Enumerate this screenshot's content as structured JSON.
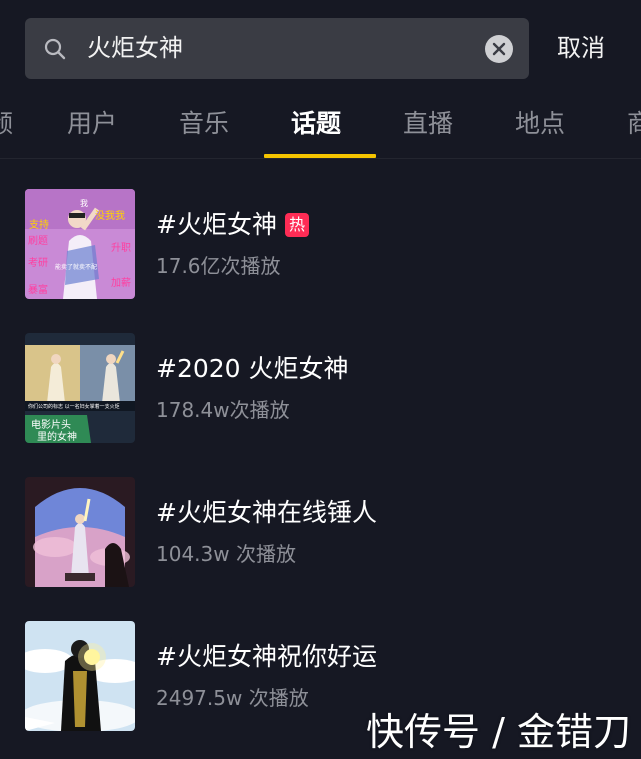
{
  "search": {
    "query": "火炬女神",
    "cancel_label": "取消"
  },
  "tabs": [
    {
      "label": "频"
    },
    {
      "label": "用户"
    },
    {
      "label": "音乐"
    },
    {
      "label": "话题"
    },
    {
      "label": "直播"
    },
    {
      "label": "地点"
    },
    {
      "label": "商"
    }
  ],
  "active_tab": "话题",
  "topics": [
    {
      "title": "#火炬女神",
      "badge": "热",
      "views": "17.6亿次播放"
    },
    {
      "title": "#2020 火炬女神",
      "views": "178.4w次播放"
    },
    {
      "title": "#火炬女神在线锤人",
      "views": "104.3w 次播放"
    },
    {
      "title": "#火炬女神祝你好运",
      "views": "2497.5w 次播放"
    }
  ],
  "thumb_texts": {
    "t1_words": [
      "我",
      "没我我",
      "刷题",
      "升职",
      "考研",
      "加薪",
      "暴富",
      "支持",
      "能卖了就卖不配"
    ],
    "t2_caption": "你们公司的标志 以一名妇女掌着一支火炬",
    "t2_label_line1": "电影片头",
    "t2_label_line2": "里的女神"
  },
  "watermark": "快传号 / 金错刀",
  "colors": {
    "background": "#161823",
    "accent": "#f5c400",
    "hot_badge": "#fe2c55",
    "muted_text": "#8e9098"
  }
}
